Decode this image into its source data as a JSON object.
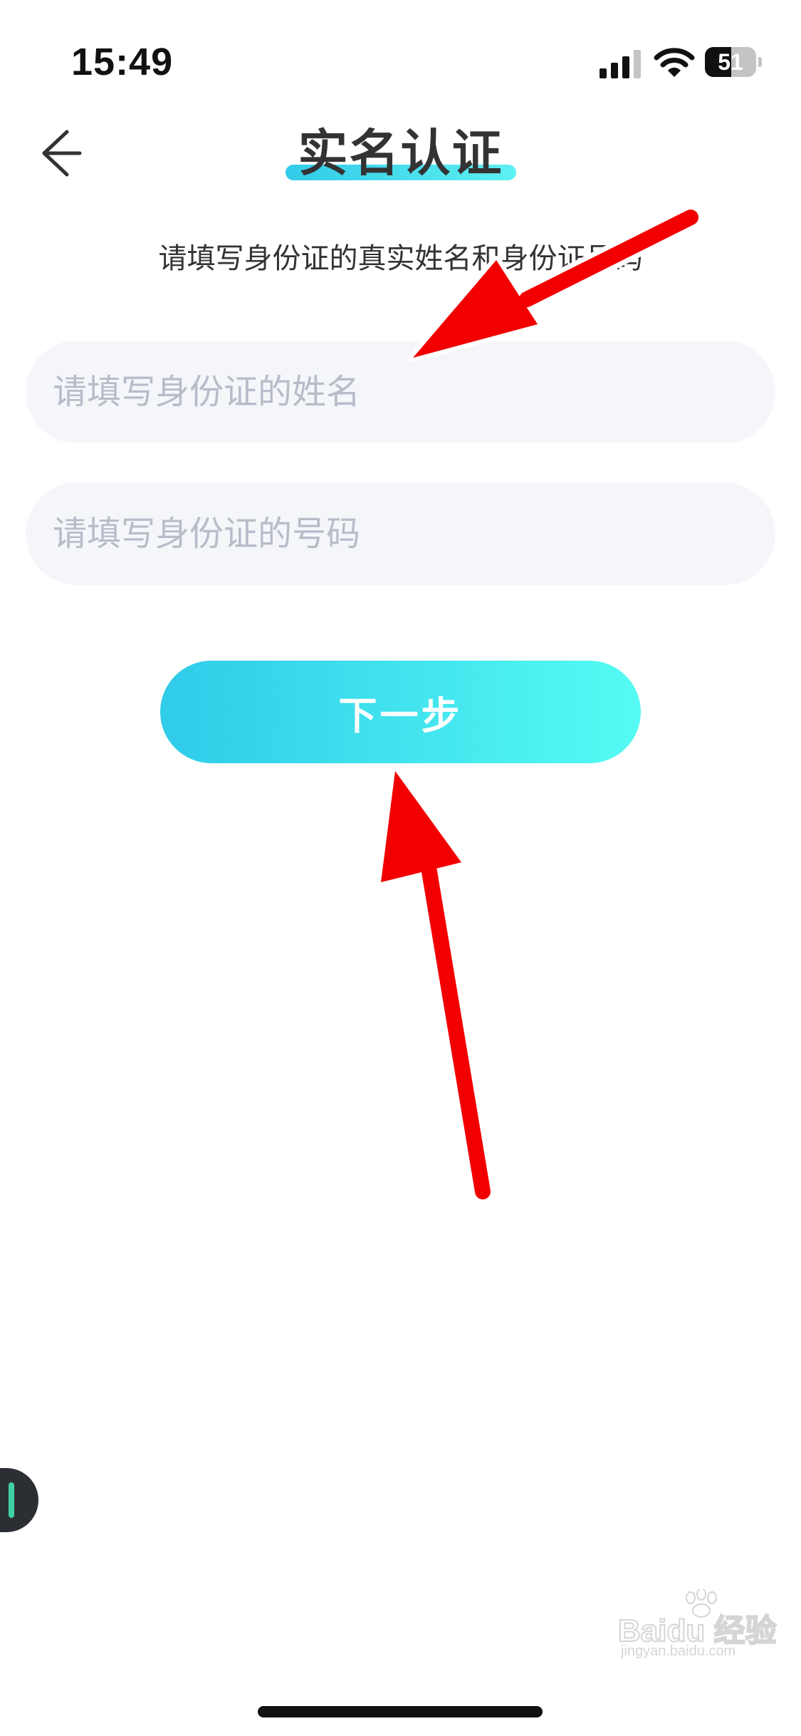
{
  "status_bar": {
    "time": "15:49",
    "battery_level": 51,
    "icons": [
      "signal-icon",
      "wifi-icon",
      "battery-icon"
    ]
  },
  "header": {
    "back_icon": "back-arrow-icon",
    "title": "实名认证",
    "title_underline_color": "#3fd8ea"
  },
  "subtitle": "请填写身份证的真实姓名和身份证号码",
  "form": {
    "name_input": {
      "value": "",
      "placeholder": "请填写身份证的姓名"
    },
    "id_input": {
      "value": "",
      "placeholder": "请填写身份证的号码"
    }
  },
  "next_button": {
    "label": "下一步",
    "gradient_start": "#2fcbe9",
    "gradient_end": "#55fbf3"
  },
  "annotations": {
    "arrow_color": "#f20000",
    "arrows": [
      "arrow-to-name-input",
      "arrow-to-next-button"
    ]
  },
  "watermark": {
    "brand": "Baidu",
    "text": "Baidu 经验",
    "url": "jingyan.baidu.com"
  },
  "colors": {
    "background": "#ffffff",
    "input_background": "#f5f6fa",
    "placeholder": "#b7bcc8",
    "text_primary": "#333333"
  }
}
